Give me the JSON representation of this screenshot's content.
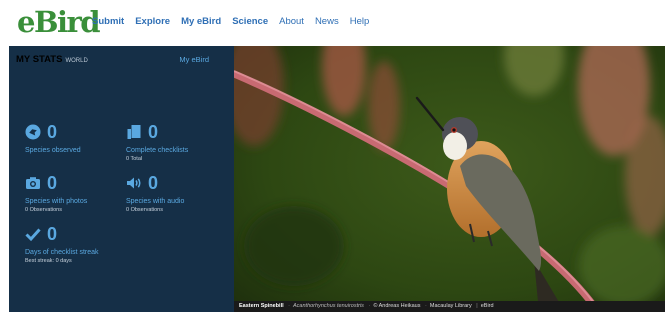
{
  "header": {
    "logo": "eBird",
    "nav": [
      {
        "label": "Submit",
        "bold": true
      },
      {
        "label": "Explore",
        "bold": true
      },
      {
        "label": "My eBird",
        "bold": true
      },
      {
        "label": "Science",
        "bold": true
      },
      {
        "label": "About",
        "bold": false
      },
      {
        "label": "News",
        "bold": false
      },
      {
        "label": "Help",
        "bold": false
      }
    ]
  },
  "stats": {
    "title": "MY STATS",
    "scope": "WORLD",
    "link": "My eBird",
    "items": [
      {
        "icon": "species-icon",
        "value": "0",
        "label": "Species observed",
        "sub": ""
      },
      {
        "icon": "checklist-icon",
        "value": "0",
        "label": "Complete checklists",
        "sub": "0 Total"
      },
      {
        "icon": "camera-icon",
        "value": "0",
        "label": "Species with photos",
        "sub": "0 Observations"
      },
      {
        "icon": "audio-icon",
        "value": "0",
        "label": "Species with audio",
        "sub": "0 Observations"
      },
      {
        "icon": "checkmark-icon",
        "value": "0",
        "label": "Days of checklist streak",
        "sub": "Best streak: 0 days"
      }
    ]
  },
  "photo": {
    "common_name": "Eastern Spinebill",
    "scientific_name": "Acanthorhynchus tenuirostris",
    "credit": "© Andreas Heikaus",
    "library": "Macaulay Library",
    "site": "eBird"
  },
  "colors": {
    "accent": "#5aa8e0",
    "panel": "#152f47",
    "logo": "#3a8f3a",
    "nav": "#2f6fb5"
  }
}
